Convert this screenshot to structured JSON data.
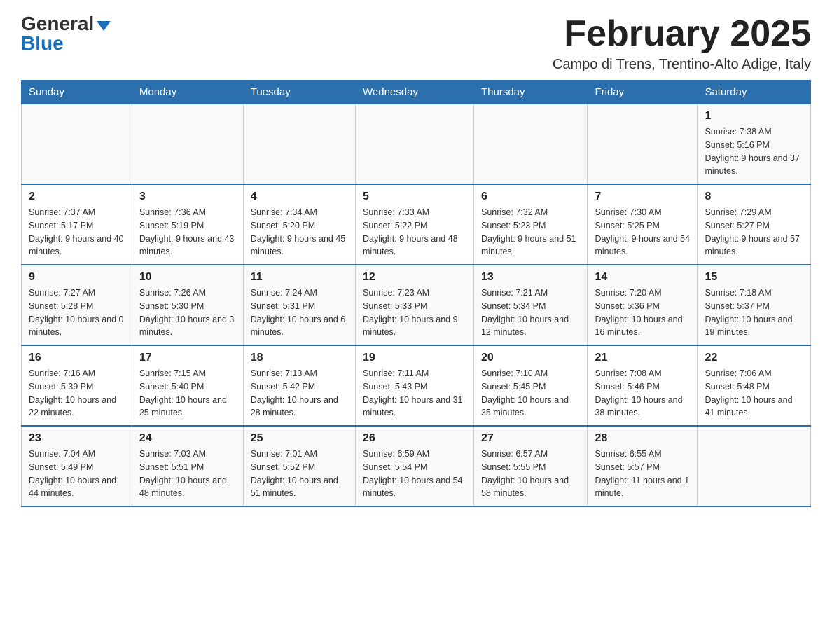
{
  "logo": {
    "general": "General",
    "blue": "Blue",
    "triangle": "▼"
  },
  "title": "February 2025",
  "subtitle": "Campo di Trens, Trentino-Alto Adige, Italy",
  "days_of_week": [
    "Sunday",
    "Monday",
    "Tuesday",
    "Wednesday",
    "Thursday",
    "Friday",
    "Saturday"
  ],
  "weeks": [
    [
      {
        "day": "",
        "info": ""
      },
      {
        "day": "",
        "info": ""
      },
      {
        "day": "",
        "info": ""
      },
      {
        "day": "",
        "info": ""
      },
      {
        "day": "",
        "info": ""
      },
      {
        "day": "",
        "info": ""
      },
      {
        "day": "1",
        "info": "Sunrise: 7:38 AM\nSunset: 5:16 PM\nDaylight: 9 hours and 37 minutes."
      }
    ],
    [
      {
        "day": "2",
        "info": "Sunrise: 7:37 AM\nSunset: 5:17 PM\nDaylight: 9 hours and 40 minutes."
      },
      {
        "day": "3",
        "info": "Sunrise: 7:36 AM\nSunset: 5:19 PM\nDaylight: 9 hours and 43 minutes."
      },
      {
        "day": "4",
        "info": "Sunrise: 7:34 AM\nSunset: 5:20 PM\nDaylight: 9 hours and 45 minutes."
      },
      {
        "day": "5",
        "info": "Sunrise: 7:33 AM\nSunset: 5:22 PM\nDaylight: 9 hours and 48 minutes."
      },
      {
        "day": "6",
        "info": "Sunrise: 7:32 AM\nSunset: 5:23 PM\nDaylight: 9 hours and 51 minutes."
      },
      {
        "day": "7",
        "info": "Sunrise: 7:30 AM\nSunset: 5:25 PM\nDaylight: 9 hours and 54 minutes."
      },
      {
        "day": "8",
        "info": "Sunrise: 7:29 AM\nSunset: 5:27 PM\nDaylight: 9 hours and 57 minutes."
      }
    ],
    [
      {
        "day": "9",
        "info": "Sunrise: 7:27 AM\nSunset: 5:28 PM\nDaylight: 10 hours and 0 minutes."
      },
      {
        "day": "10",
        "info": "Sunrise: 7:26 AM\nSunset: 5:30 PM\nDaylight: 10 hours and 3 minutes."
      },
      {
        "day": "11",
        "info": "Sunrise: 7:24 AM\nSunset: 5:31 PM\nDaylight: 10 hours and 6 minutes."
      },
      {
        "day": "12",
        "info": "Sunrise: 7:23 AM\nSunset: 5:33 PM\nDaylight: 10 hours and 9 minutes."
      },
      {
        "day": "13",
        "info": "Sunrise: 7:21 AM\nSunset: 5:34 PM\nDaylight: 10 hours and 12 minutes."
      },
      {
        "day": "14",
        "info": "Sunrise: 7:20 AM\nSunset: 5:36 PM\nDaylight: 10 hours and 16 minutes."
      },
      {
        "day": "15",
        "info": "Sunrise: 7:18 AM\nSunset: 5:37 PM\nDaylight: 10 hours and 19 minutes."
      }
    ],
    [
      {
        "day": "16",
        "info": "Sunrise: 7:16 AM\nSunset: 5:39 PM\nDaylight: 10 hours and 22 minutes."
      },
      {
        "day": "17",
        "info": "Sunrise: 7:15 AM\nSunset: 5:40 PM\nDaylight: 10 hours and 25 minutes."
      },
      {
        "day": "18",
        "info": "Sunrise: 7:13 AM\nSunset: 5:42 PM\nDaylight: 10 hours and 28 minutes."
      },
      {
        "day": "19",
        "info": "Sunrise: 7:11 AM\nSunset: 5:43 PM\nDaylight: 10 hours and 31 minutes."
      },
      {
        "day": "20",
        "info": "Sunrise: 7:10 AM\nSunset: 5:45 PM\nDaylight: 10 hours and 35 minutes."
      },
      {
        "day": "21",
        "info": "Sunrise: 7:08 AM\nSunset: 5:46 PM\nDaylight: 10 hours and 38 minutes."
      },
      {
        "day": "22",
        "info": "Sunrise: 7:06 AM\nSunset: 5:48 PM\nDaylight: 10 hours and 41 minutes."
      }
    ],
    [
      {
        "day": "23",
        "info": "Sunrise: 7:04 AM\nSunset: 5:49 PM\nDaylight: 10 hours and 44 minutes."
      },
      {
        "day": "24",
        "info": "Sunrise: 7:03 AM\nSunset: 5:51 PM\nDaylight: 10 hours and 48 minutes."
      },
      {
        "day": "25",
        "info": "Sunrise: 7:01 AM\nSunset: 5:52 PM\nDaylight: 10 hours and 51 minutes."
      },
      {
        "day": "26",
        "info": "Sunrise: 6:59 AM\nSunset: 5:54 PM\nDaylight: 10 hours and 54 minutes."
      },
      {
        "day": "27",
        "info": "Sunrise: 6:57 AM\nSunset: 5:55 PM\nDaylight: 10 hours and 58 minutes."
      },
      {
        "day": "28",
        "info": "Sunrise: 6:55 AM\nSunset: 5:57 PM\nDaylight: 11 hours and 1 minute."
      },
      {
        "day": "",
        "info": ""
      }
    ]
  ]
}
